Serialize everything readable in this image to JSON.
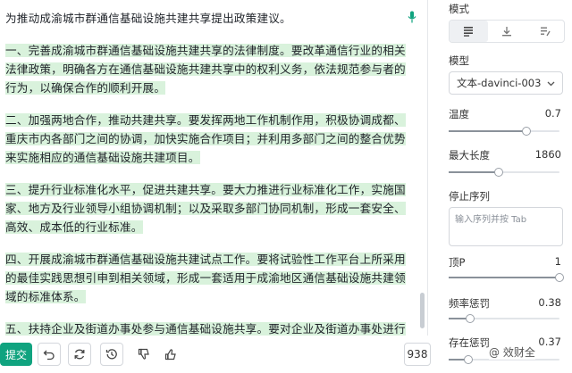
{
  "editor": {
    "prompt": "为推动成渝城市群通信基础设施共建共享提出政策建议。",
    "paragraphs": [
      "一、完善成渝城市群通信基础设施共建共享的法律制度。要改革通信行业的相关法律政策，明确各方在通信基础设施共建共享中的权利义务，依法规范参与者的行为，以确保合作的顺利开展。",
      "二、加强两地合作，推动共建共享。要发挥两地工作机制作用，积极协调成都、重庆市内各部门之间的协调，加快实施合作项目；并利用多部门之间的整合优势来实施相应的通信基础设施共建项目。",
      "三、提升行业标准化水平，促进共建共享。要大力推进行业标准化工作，实施国家、地方及行业领导小组协调机制；以及采取多部门协同机制，形成一套安全、高效、成本低的行业标准。",
      "四、开展成渝城市群通信基础设施共建试点工作。要将试验性工作平台上所采用的最佳实践思想引申到相关领域，形成一套适用于成渝地区通信基础设施共建领域的标准体系。",
      "五、扶持企业及街道办事处参与通信基础设施共享。要对企业及街道办事处进行扶持，降低他们参与通信基础设施共享的风险；并对他们进行奖励性补贴；并根据不"
    ]
  },
  "toolbar": {
    "submit_label": "提交",
    "token_count": "938"
  },
  "settings": {
    "mode_label": "模式",
    "model_label": "模型",
    "model_value": "文本-davinci-003",
    "temperature": {
      "label": "温度",
      "value": "0.7",
      "fraction": 0.7
    },
    "max_length": {
      "label": "最大长度",
      "value": "1860",
      "fraction": 0.45
    },
    "stop_sequence": {
      "label": "停止序列",
      "placeholder": "输入序列并按 Tab"
    },
    "top_p": {
      "label": "顶P",
      "value": "1",
      "fraction": 1.0
    },
    "frequency_penalty": {
      "label": "频率惩罚",
      "value": "0.38",
      "fraction": 0.19
    },
    "presence_penalty": {
      "label": "存在惩罚",
      "value": "0.37",
      "fraction": 0.18
    }
  },
  "watermark": "@ 效财全",
  "colors": {
    "accent": "#10a37f",
    "highlight": "#d9f2dc"
  },
  "icons": [
    "microphone-icon",
    "undo-icon",
    "regenerate-icon",
    "history-icon",
    "thumbs-down-icon",
    "thumbs-up-icon",
    "mode-complete-icon",
    "mode-insert-icon",
    "mode-edit-icon",
    "chevron-down-icon"
  ]
}
